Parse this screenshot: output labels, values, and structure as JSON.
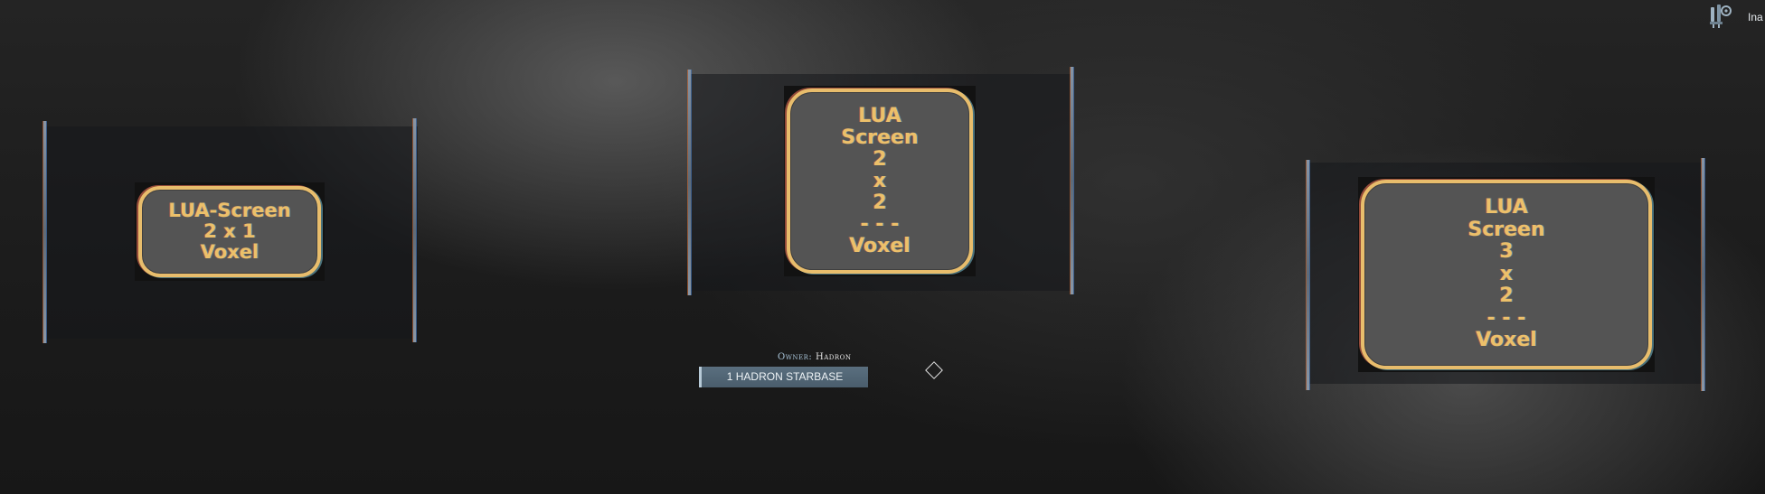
{
  "screens": [
    {
      "lines": [
        "LUA-Screen",
        "2 x 1",
        "Voxel"
      ]
    },
    {
      "lines": [
        "LUA",
        "Screen",
        "2",
        "x",
        "2",
        "- - -",
        "Voxel"
      ]
    },
    {
      "lines": [
        "LUA",
        "Screen",
        "3",
        "x",
        "2",
        "- - -",
        "Voxel"
      ]
    }
  ],
  "hud": {
    "owner_key": "Owner:",
    "owner_value": "Hadron",
    "construct_tag": "1 HADRON STARBASE",
    "waypoint_icon": "diamond-marker-icon",
    "tool_icon": "tool-icon",
    "status_text": "Ina"
  },
  "colors": {
    "screen_border": "#e8bd6c",
    "screen_text": "#ecc06a",
    "screen_fill": "#545454",
    "tag_background": "#4f6373"
  }
}
